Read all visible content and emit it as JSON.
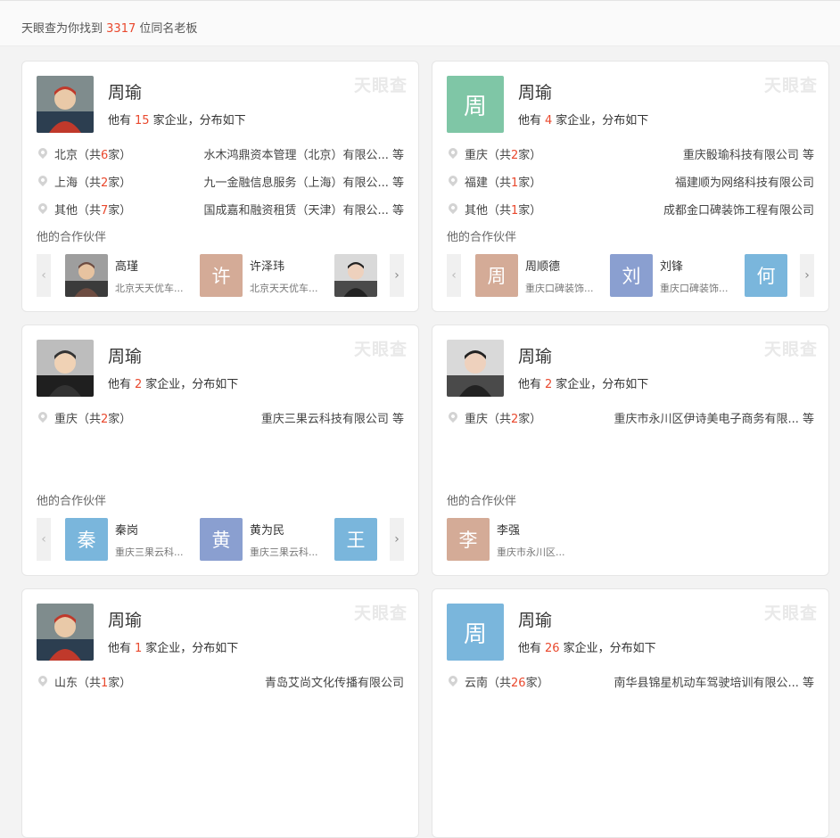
{
  "header": {
    "prefix": "天眼查为你找到",
    "count": "3317",
    "suffix": "位同名老板"
  },
  "watermark": "天眼查",
  "partners_title": "他的合作伙伴",
  "summary_prefix": "他有",
  "summary_suffix": "家企业，分布如下",
  "cards": [
    {
      "name": "周瑜",
      "count": "15",
      "avatar_type": "photo",
      "regions": [
        {
          "label": "北京（共",
          "n": "6",
          "tail": "家）",
          "company": "水木鸿鼎资本管理（北京）有限公... 等"
        },
        {
          "label": "上海（共",
          "n": "2",
          "tail": "家）",
          "company": "九一金融信息服务（上海）有限公... 等"
        },
        {
          "label": "其他（共",
          "n": "7",
          "tail": "家）",
          "company": "国成嘉和融资租赁（天津）有限公... 等"
        }
      ],
      "partners": [
        {
          "name": "高瑾",
          "company": "北京天天优车...",
          "avatar_type": "photo"
        },
        {
          "name": "许泽玮",
          "company": "北京天天优车...",
          "avatar_char": "许",
          "color": "#d4ab97"
        },
        {
          "name": "",
          "company": "",
          "avatar_type": "photo"
        }
      ]
    },
    {
      "name": "周瑜",
      "count": "4",
      "avatar_char": "周",
      "color": "#7fc6a6",
      "regions": [
        {
          "label": "重庆（共",
          "n": "2",
          "tail": "家）",
          "company": "重庆骰瑜科技有限公司 等"
        },
        {
          "label": "福建（共",
          "n": "1",
          "tail": "家）",
          "company": "福建顺为网络科技有限公司"
        },
        {
          "label": "其他（共",
          "n": "1",
          "tail": "家）",
          "company": "成都金口碑装饰工程有限公司"
        }
      ],
      "partners": [
        {
          "name": "周顺德",
          "company": "重庆口碑装饰...",
          "avatar_char": "周",
          "color": "#d4ab97"
        },
        {
          "name": "刘锋",
          "company": "重庆口碑装饰...",
          "avatar_char": "刘",
          "color": "#8a9fd0"
        },
        {
          "name": "",
          "company": "",
          "avatar_char": "何",
          "color": "#7ab6dc"
        }
      ]
    },
    {
      "name": "周瑜",
      "count": "2",
      "avatar_type": "photo",
      "regions": [
        {
          "label": "重庆（共",
          "n": "2",
          "tail": "家）",
          "company": "重庆三果云科技有限公司 等"
        }
      ],
      "partners": [
        {
          "name": "秦岗",
          "company": "重庆三果云科...",
          "avatar_char": "秦",
          "color": "#7ab6dc"
        },
        {
          "name": "黄为民",
          "company": "重庆三果云科...",
          "avatar_char": "黄",
          "color": "#8a9fd0"
        },
        {
          "name": "",
          "company": "",
          "avatar_char": "王",
          "color": "#7ab6dc"
        }
      ]
    },
    {
      "name": "周瑜",
      "count": "2",
      "avatar_type": "photo",
      "regions": [
        {
          "label": "重庆（共",
          "n": "2",
          "tail": "家）",
          "company": "重庆市永川区伊诗美电子商务有限... 等"
        }
      ],
      "partners": [
        {
          "name": "李强",
          "company": "重庆市永川区...",
          "avatar_char": "李",
          "color": "#d4ab97"
        }
      ]
    },
    {
      "name": "周瑜",
      "count": "1",
      "avatar_type": "photo",
      "regions": [
        {
          "label": "山东（共",
          "n": "1",
          "tail": "家）",
          "company": "青岛艾尚文化传播有限公司"
        }
      ],
      "partners": []
    },
    {
      "name": "周瑜",
      "count": "26",
      "avatar_char": "周",
      "color": "#7ab6dc",
      "regions": [
        {
          "label": "云南（共",
          "n": "26",
          "tail": "家）",
          "company": "南华县锦星机动车驾驶培训有限公... 等"
        }
      ],
      "partners": []
    }
  ]
}
